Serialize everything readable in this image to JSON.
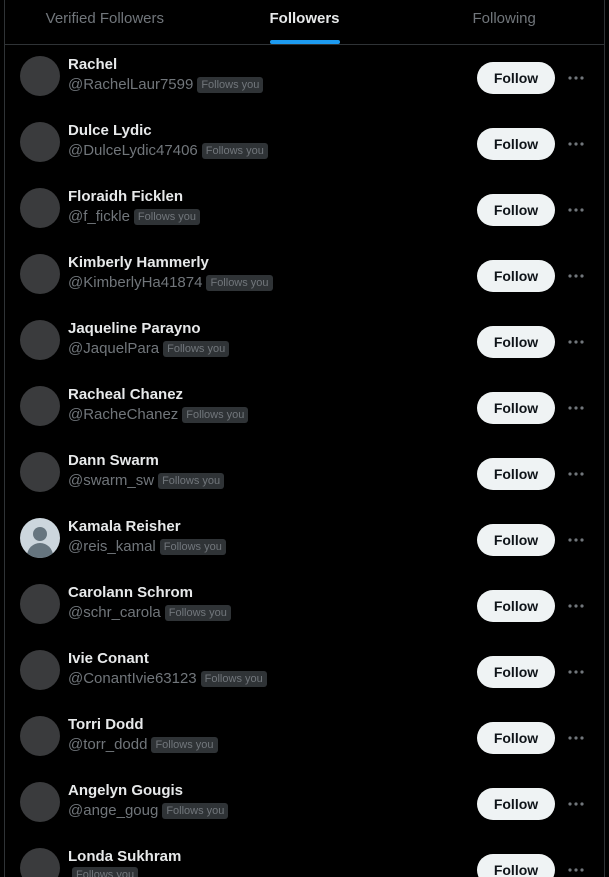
{
  "tabs": [
    {
      "label": "Verified Followers",
      "active": false
    },
    {
      "label": "Followers",
      "active": true
    },
    {
      "label": "Following",
      "active": false
    }
  ],
  "follow_label": "Follows you",
  "button_label": "Follow",
  "users": [
    {
      "name": "Rachel",
      "handle": "@RachelLaur7599",
      "avatar": "dark"
    },
    {
      "name": "Dulce Lydic",
      "handle": "@DulceLydic47406",
      "avatar": "dark"
    },
    {
      "name": "Floraidh Ficklen",
      "handle": "@f_fickle",
      "avatar": "dark"
    },
    {
      "name": "Kimberly Hammerly",
      "handle": "@KimberlyHa41874",
      "avatar": "dark"
    },
    {
      "name": "Jaqueline Parayno",
      "handle": "@JaquelPara",
      "avatar": "dark"
    },
    {
      "name": "Racheal Chanez",
      "handle": "@RacheChanez",
      "avatar": "dark"
    },
    {
      "name": "Dann Swarm",
      "handle": "@swarm_sw",
      "avatar": "dark"
    },
    {
      "name": "Kamala Reisher",
      "handle": "@reis_kamal",
      "avatar": "default"
    },
    {
      "name": "Carolann Schrom",
      "handle": "@schr_carola",
      "avatar": "dark"
    },
    {
      "name": "Ivie Conant",
      "handle": "@ConantIvie63123",
      "avatar": "dark"
    },
    {
      "name": "Torri Dodd",
      "handle": "@torr_dodd",
      "avatar": "dark"
    },
    {
      "name": "Angelyn Gougis",
      "handle": "@ange_goug",
      "avatar": "dark"
    },
    {
      "name": "Londa Sukhram",
      "handle": "",
      "avatar": "dark"
    }
  ],
  "colors": {
    "background": "#000000",
    "accent": "#1d9bf0",
    "text_primary": "#e7e9ea",
    "text_secondary": "#71767b",
    "button_bg": "#eff3f4"
  },
  "icons": {
    "more": "more-horizontal-icon"
  }
}
